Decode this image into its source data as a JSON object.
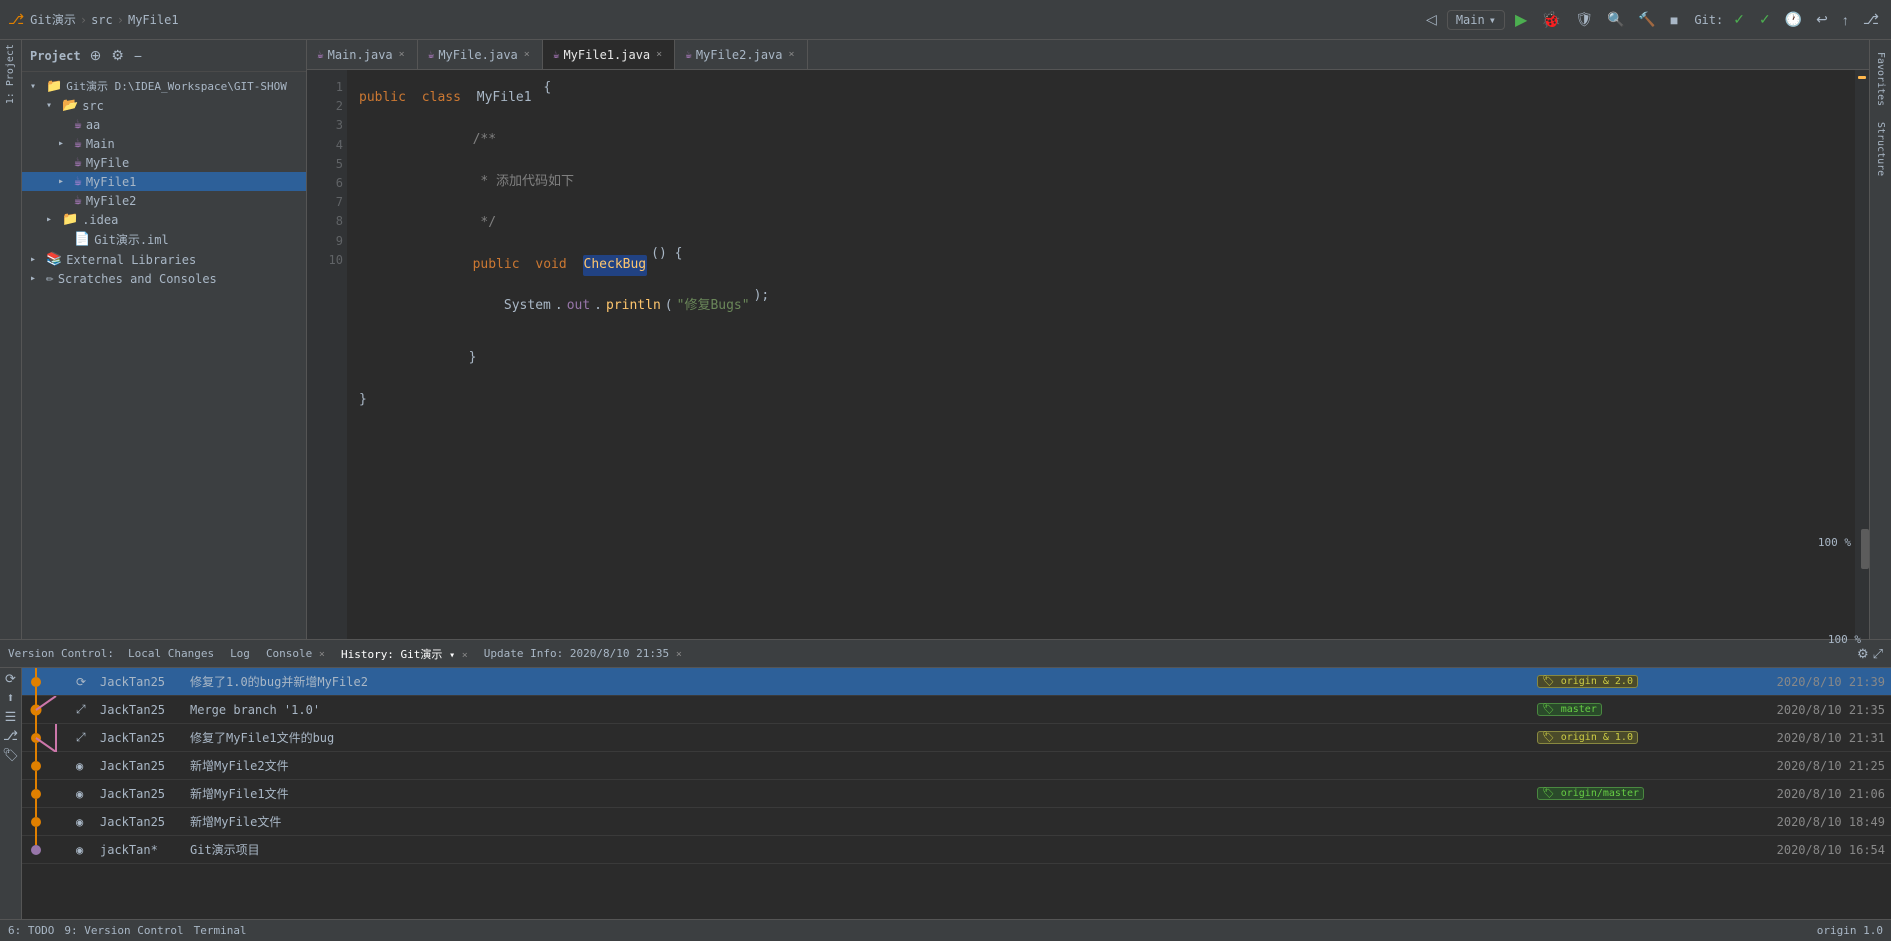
{
  "toolbar": {
    "breadcrumb": [
      "Git演示",
      "src",
      "MyFile1"
    ],
    "run_config": "Main",
    "git_label": "Git:"
  },
  "tabs": [
    {
      "label": "Main.java",
      "modified": false,
      "active": false
    },
    {
      "label": "MyFile.java",
      "modified": false,
      "active": false
    },
    {
      "label": "MyFile1.java",
      "modified": false,
      "active": true
    },
    {
      "label": "MyFile2.java",
      "modified": false,
      "active": false
    }
  ],
  "sidebar": {
    "title": "Project",
    "tree": [
      {
        "indent": 0,
        "type": "root",
        "label": "Git演示 D:\\IDEA_Workspace\\GIT-SHOW",
        "expanded": true
      },
      {
        "indent": 1,
        "type": "folder",
        "label": "src",
        "expanded": true
      },
      {
        "indent": 2,
        "type": "java",
        "label": "aa"
      },
      {
        "indent": 2,
        "type": "java",
        "label": "Main",
        "expanded": true
      },
      {
        "indent": 2,
        "type": "java",
        "label": "MyFile"
      },
      {
        "indent": 2,
        "type": "java",
        "label": "MyFile1",
        "selected": true,
        "expanded": true
      },
      {
        "indent": 2,
        "type": "java",
        "label": "MyFile2"
      },
      {
        "indent": 1,
        "type": "folder",
        "label": ".idea",
        "expanded": false
      },
      {
        "indent": 1,
        "type": "file",
        "label": "Git演示.iml"
      },
      {
        "indent": 0,
        "type": "folder",
        "label": "External Libraries",
        "expanded": false
      },
      {
        "indent": 0,
        "type": "scratches",
        "label": "Scratches and Consoles",
        "expanded": false
      }
    ]
  },
  "code": {
    "lines": [
      "public class MyFile1 {",
      "    /**",
      "     * 添加代码如下",
      "     */",
      "    public void CheckBug() {",
      "        System.out.println(\"修复Bugs\");",
      "    }",
      "}",
      "",
      ""
    ]
  },
  "bottom_panel": {
    "version_control_label": "Version Control:",
    "tabs": [
      {
        "label": "Local Changes",
        "active": false,
        "closeable": false
      },
      {
        "label": "Log",
        "active": false,
        "closeable": false
      },
      {
        "label": "Console",
        "active": false,
        "closeable": true
      },
      {
        "label": "History: Git演示",
        "active": true,
        "closeable": true
      },
      {
        "label": "Update Info: 2020/8/10 21:35",
        "active": false,
        "closeable": true
      }
    ],
    "git_log": [
      {
        "icon": "refresh",
        "author": "JackTan25",
        "message": "修复了1.0的bug并新增MyFile2",
        "tags": [
          "origin & 2.0"
        ],
        "tag_types": [
          "origin"
        ],
        "date": "2020/8/10 21:39",
        "selected": true,
        "graph_color": "orange"
      },
      {
        "icon": "merge",
        "author": "JackTan25",
        "message": "Merge branch '1.0'",
        "tags": [
          "master"
        ],
        "tag_types": [
          "master"
        ],
        "date": "2020/8/10 21:35",
        "selected": false,
        "graph_color": "orange"
      },
      {
        "icon": "merge",
        "author": "JackTan25",
        "message": "修复了MyFile1文件的bug",
        "tags": [
          "origin & 1.0"
        ],
        "tag_types": [
          "origin"
        ],
        "date": "2020/8/10 21:31",
        "selected": false,
        "graph_color": "orange"
      },
      {
        "icon": "commit",
        "author": "JackTan25",
        "message": "新增MyFile2文件",
        "tags": [],
        "date": "2020/8/10 21:25",
        "selected": false,
        "graph_color": "orange"
      },
      {
        "icon": "commit",
        "author": "JackTan25",
        "message": "新增MyFile1文件",
        "tags": [
          "origin/master"
        ],
        "tag_types": [
          "origin-master"
        ],
        "date": "2020/8/10 21:06",
        "selected": false,
        "graph_color": "orange"
      },
      {
        "icon": "commit",
        "author": "JackTan25",
        "message": "新增MyFile文件",
        "tags": [],
        "date": "2020/8/10 18:49",
        "selected": false,
        "graph_color": "orange"
      },
      {
        "icon": "commit",
        "author": "jackTan*",
        "message": "Git演示项目",
        "tags": [],
        "date": "2020/8/10 16:54",
        "selected": false,
        "graph_color": "purple"
      }
    ]
  },
  "status_bar": {
    "todo_label": "6: TODO",
    "vc_label": "9: Version Control",
    "terminal_label": "Terminal",
    "origin_label": "origin 1.0"
  },
  "zoom": "100 %"
}
